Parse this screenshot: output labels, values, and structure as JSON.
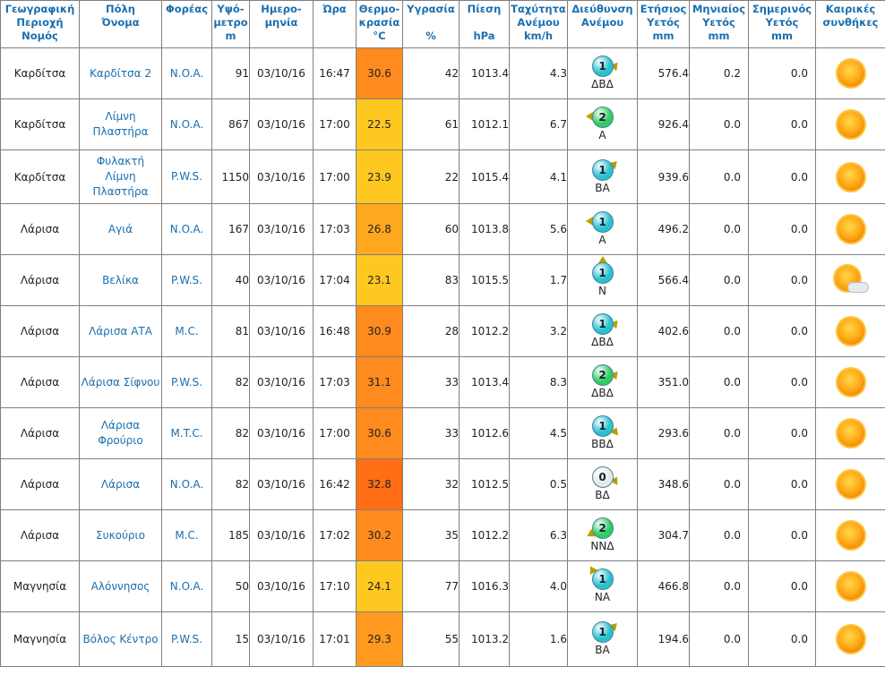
{
  "headers": [
    [
      "Γεωγραφική",
      "Περιοχή",
      "Νομός"
    ],
    [
      "Πόλη",
      "Όνομα"
    ],
    [
      "Φορέας"
    ],
    [
      "Υψό-",
      "μετρο",
      "m"
    ],
    [
      "Ημερο-",
      "μηνία"
    ],
    [
      "Ώρα"
    ],
    [
      "Θερμο-",
      "κρασία",
      "°C"
    ],
    [
      "Υγρασία",
      "",
      "%"
    ],
    [
      "Πίεση",
      "",
      "hPa"
    ],
    [
      "Ταχύτητα",
      "Ανέμου",
      "km/h"
    ],
    [
      "Διεύθυνση",
      "Ανέμου"
    ],
    [
      "Ετήσιος",
      "Υετός",
      "mm"
    ],
    [
      "Μηνιαίος",
      "Υετός",
      "mm"
    ],
    [
      "Σημερινός",
      "Υετός",
      "mm"
    ],
    [
      "Καιρικές",
      "συνθήκες"
    ]
  ],
  "rows": [
    {
      "region": "Καρδίτσα",
      "city": "Καρδίτσα 2",
      "agency": "N.O.A.",
      "alt": "91",
      "date": "03/10/16",
      "time": "16:47",
      "temp": "30.6",
      "temp_color": "#ff8a1e",
      "hum": "42",
      "press": "1013.4",
      "wspd": "4.3",
      "beaufort": "1",
      "ball_color": "#27c2cf",
      "wdir": "ΔΒΔ",
      "yearly": "576.4",
      "monthly": "0.2",
      "today": "0.0",
      "cond": "sunny"
    },
    {
      "region": "Καρδίτσα",
      "city": "Λίμνη Πλαστήρα",
      "agency": "N.O.A.",
      "alt": "867",
      "date": "03/10/16",
      "time": "17:00",
      "temp": "22.5",
      "temp_color": "#ffc820",
      "hum": "61",
      "press": "1012.1",
      "wspd": "6.7",
      "beaufort": "2",
      "ball_color": "#2fcc60",
      "wdir": "Α",
      "yearly": "926.4",
      "monthly": "0.0",
      "today": "0.0",
      "cond": "sunny"
    },
    {
      "region": "Καρδίτσα",
      "city": "Φυλακτή Λίμνη Πλαστήρα",
      "agency": "P.W.S.",
      "alt": "1150",
      "date": "03/10/16",
      "time": "17:00",
      "temp": "23.9",
      "temp_color": "#ffc820",
      "hum": "22",
      "press": "1015.4",
      "wspd": "4.1",
      "beaufort": "1",
      "ball_color": "#27c2cf",
      "wdir": "ΒΑ",
      "yearly": "939.6",
      "monthly": "0.0",
      "today": "0.0",
      "cond": "sunny"
    },
    {
      "region": "Λάρισα",
      "city": "Αγιά",
      "agency": "N.O.A.",
      "alt": "167",
      "date": "03/10/16",
      "time": "17:03",
      "temp": "26.8",
      "temp_color": "#ffa81e",
      "hum": "60",
      "press": "1013.8",
      "wspd": "5.6",
      "beaufort": "1",
      "ball_color": "#27c2cf",
      "wdir": "Α",
      "yearly": "496.2",
      "monthly": "0.0",
      "today": "0.0",
      "cond": "sunny"
    },
    {
      "region": "Λάρισα",
      "city": "Βελίκα",
      "agency": "P.W.S.",
      "alt": "40",
      "date": "03/10/16",
      "time": "17:04",
      "temp": "23.1",
      "temp_color": "#ffc820",
      "hum": "83",
      "press": "1015.5",
      "wspd": "1.7",
      "beaufort": "1",
      "ball_color": "#27c2cf",
      "wdir": "Ν",
      "yearly": "566.4",
      "monthly": "0.0",
      "today": "0.0",
      "cond": "partly-cloudy"
    },
    {
      "region": "Λάρισα",
      "city": "Λάρισα ΑΤΑ",
      "agency": "M.C.",
      "alt": "81",
      "date": "03/10/16",
      "time": "16:48",
      "temp": "30.9",
      "temp_color": "#ff8a1e",
      "hum": "28",
      "press": "1012.2",
      "wspd": "3.2",
      "beaufort": "1",
      "ball_color": "#27c2cf",
      "wdir": "ΔΒΔ",
      "yearly": "402.6",
      "monthly": "0.0",
      "today": "0.0",
      "cond": "sunny"
    },
    {
      "region": "Λάρισα",
      "city": "Λάρισα Σίφνου",
      "agency": "P.W.S.",
      "alt": "82",
      "date": "03/10/16",
      "time": "17:03",
      "temp": "31.1",
      "temp_color": "#ff8a1e",
      "hum": "33",
      "press": "1013.4",
      "wspd": "8.3",
      "beaufort": "2",
      "ball_color": "#2fcc60",
      "wdir": "ΔΒΔ",
      "yearly": "351.0",
      "monthly": "0.0",
      "today": "0.0",
      "cond": "sunny"
    },
    {
      "region": "Λάρισα",
      "city": "Λάρισα Φρούριο",
      "agency": "M.T.C.",
      "alt": "82",
      "date": "03/10/16",
      "time": "17:00",
      "temp": "30.6",
      "temp_color": "#ff8a1e",
      "hum": "33",
      "press": "1012.6",
      "wspd": "4.5",
      "beaufort": "1",
      "ball_color": "#27c2cf",
      "wdir": "ΒΒΔ",
      "yearly": "293.6",
      "monthly": "0.0",
      "today": "0.0",
      "cond": "sunny"
    },
    {
      "region": "Λάρισα",
      "city": "Λάρισα",
      "agency": "N.O.A.",
      "alt": "82",
      "date": "03/10/16",
      "time": "16:42",
      "temp": "32.8",
      "temp_color": "#ff6e14",
      "hum": "32",
      "press": "1012.5",
      "wspd": "0.5",
      "beaufort": "0",
      "ball_color": "#e8e8e8",
      "wdir": "ΒΔ",
      "yearly": "348.6",
      "monthly": "0.0",
      "today": "0.0",
      "cond": "sunny"
    },
    {
      "region": "Λάρισα",
      "city": "Συκούριο",
      "agency": "M.C.",
      "alt": "185",
      "date": "03/10/16",
      "time": "17:02",
      "temp": "30.2",
      "temp_color": "#ff8a1e",
      "hum": "35",
      "press": "1012.2",
      "wspd": "6.3",
      "beaufort": "2",
      "ball_color": "#2fcc60",
      "wdir": "ΝΝΔ",
      "yearly": "304.7",
      "monthly": "0.0",
      "today": "0.0",
      "cond": "sunny"
    },
    {
      "region": "Μαγνησία",
      "city": "Αλόννησος",
      "agency": "N.O.A.",
      "alt": "50",
      "date": "03/10/16",
      "time": "17:10",
      "temp": "24.1",
      "temp_color": "#ffc820",
      "hum": "77",
      "press": "1016.3",
      "wspd": "4.0",
      "beaufort": "1",
      "ball_color": "#27c2cf",
      "wdir": "ΝΑ",
      "yearly": "466.8",
      "monthly": "0.0",
      "today": "0.0",
      "cond": "sunny"
    },
    {
      "region": "Μαγνησία",
      "city": "Βόλος Κέντρο",
      "agency": "P.W.S.",
      "alt": "15",
      "date": "03/10/16",
      "time": "17:01",
      "temp": "29.3",
      "temp_color": "#ff9a1e",
      "hum": "55",
      "press": "1013.2",
      "wspd": "1.6",
      "beaufort": "1",
      "ball_color": "#27c2cf",
      "wdir": "ΒΑ",
      "yearly": "194.6",
      "monthly": "0.0",
      "today": "0.0",
      "cond": "sunny"
    }
  ]
}
